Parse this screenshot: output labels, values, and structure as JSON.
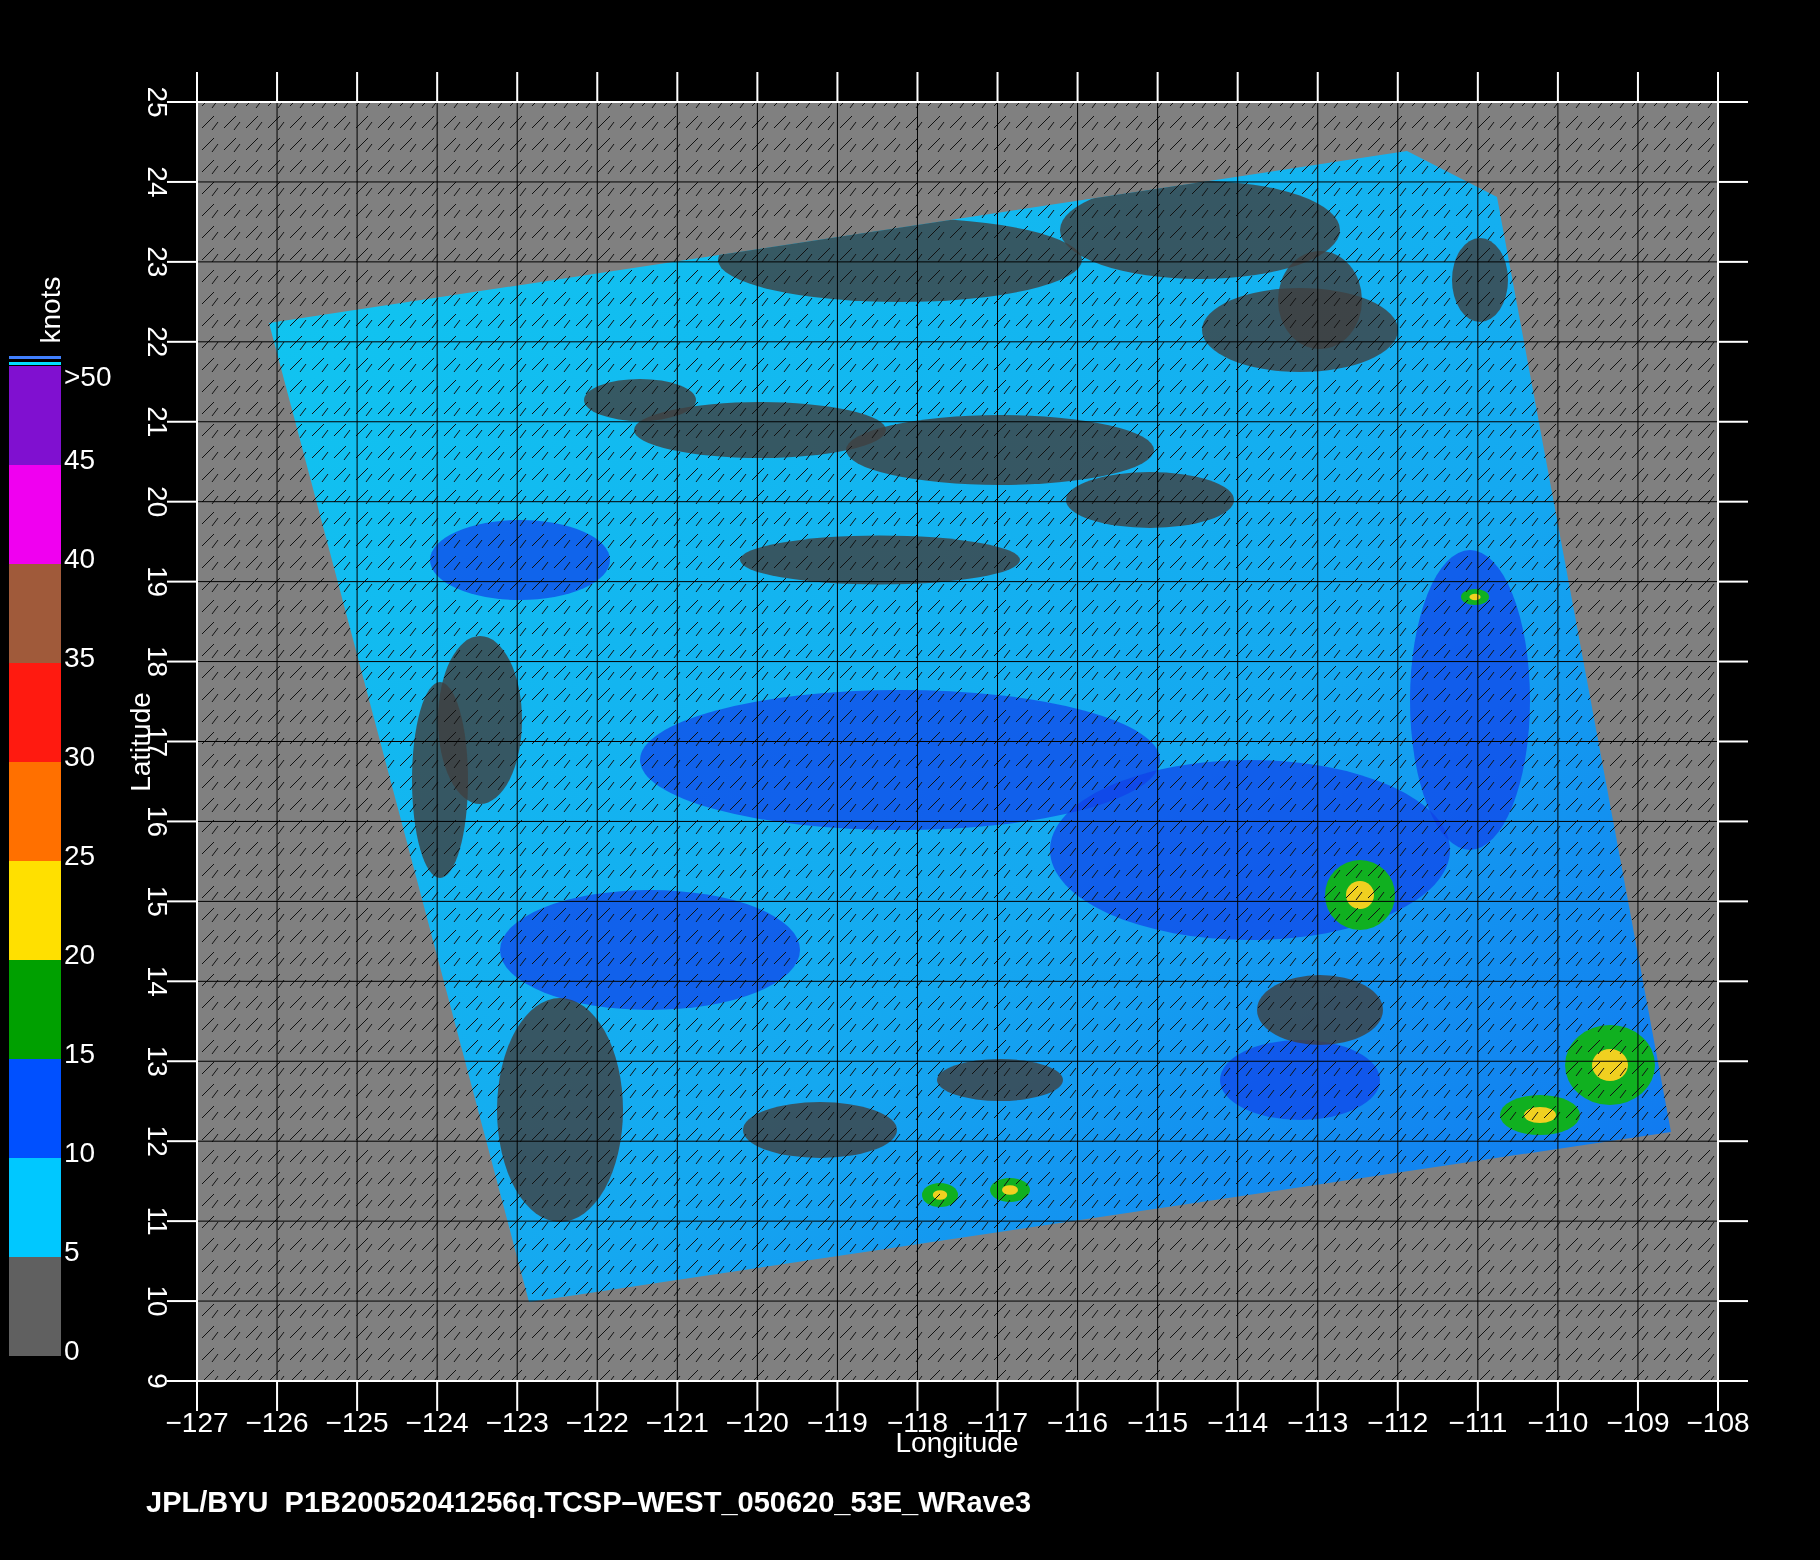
{
  "plot": {
    "xlabel": "Longitude",
    "ylabel": "Latitude",
    "x_tick_labels": [
      "−127",
      "−126",
      "−125",
      "−124",
      "−123",
      "−122",
      "−121",
      "−120",
      "−119",
      "−118",
      "−117",
      "−116",
      "−115",
      "−114",
      "−113",
      "−112",
      "−111",
      "−110",
      "−109",
      "−108"
    ],
    "y_tick_labels": [
      "9",
      "10",
      "11",
      "12",
      "13",
      "14",
      "15",
      "16",
      "17",
      "18",
      "19",
      "20",
      "21",
      "22",
      "23",
      "24",
      "25"
    ]
  },
  "colorbar": {
    "unit": "knots",
    "top_label": ">50",
    "bands": [
      {
        "label": "45",
        "color": "#8010d0"
      },
      {
        "label": "40",
        "color": "#f000f0"
      },
      {
        "label": "35",
        "color": "#a05a3a"
      },
      {
        "label": "30",
        "color": "#ff1a10"
      },
      {
        "label": "25",
        "color": "#ff7000"
      },
      {
        "label": "20",
        "color": "#ffe000"
      },
      {
        "label": "15",
        "color": "#00a000"
      },
      {
        "label": "10",
        "color": "#0050ff"
      },
      {
        "label": "5",
        "color": "#00c8ff"
      },
      {
        "label": "0",
        "color": "#606060"
      }
    ]
  },
  "caption": "JPL/BYU  P1B20052041256q.TCSP–WEST_050620_53E_WRave3"
}
